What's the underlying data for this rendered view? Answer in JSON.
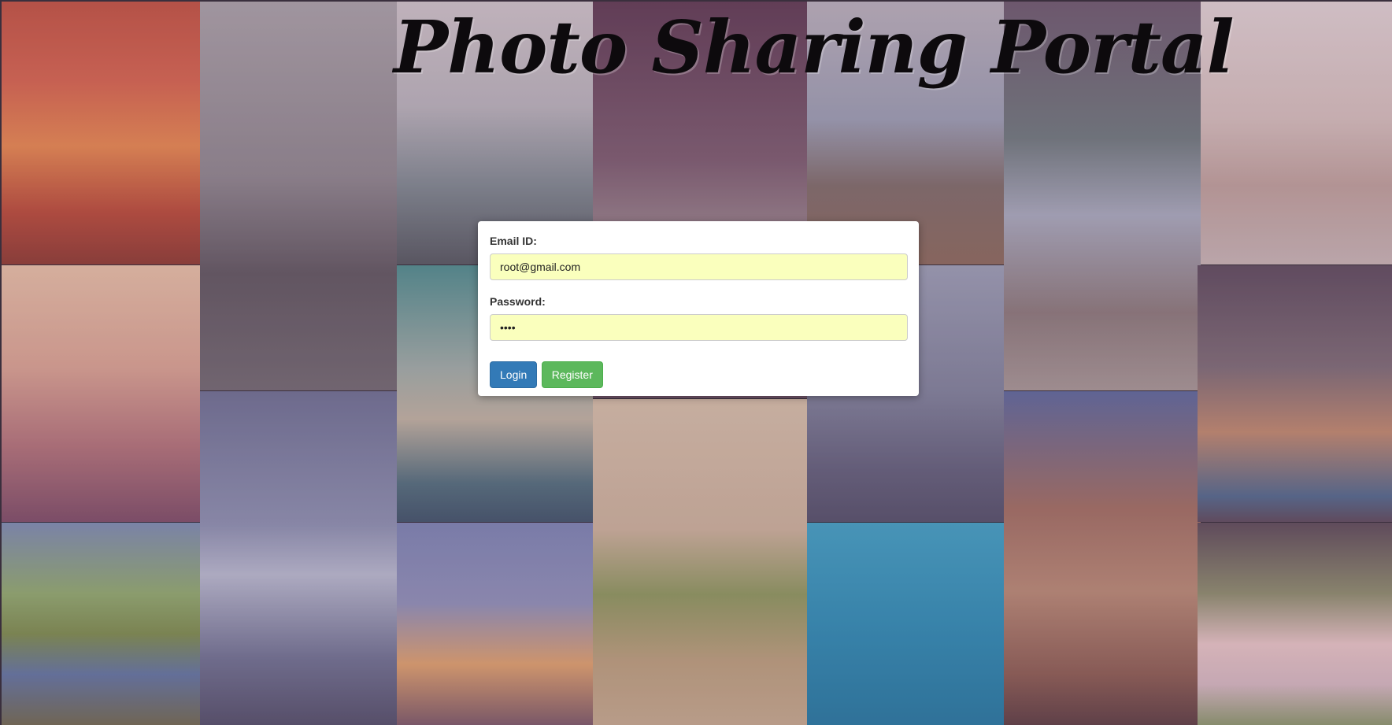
{
  "header": {
    "title": "Photo Sharing Portal"
  },
  "login_form": {
    "email_label": "Email ID:",
    "email_value": "root@gmail.com",
    "password_label": "Password:",
    "password_value": "••••",
    "login_label": "Login",
    "register_label": "Register"
  },
  "colors": {
    "login_button": "#337ab7",
    "register_button": "#5cb85c",
    "autofill_field": "#faffbd"
  },
  "background_photos": [
    "sunset-pier-photo",
    "woman-sweeping-photo",
    "city-skyline-photo",
    "child-window-photo",
    "coastal-cliff-photo",
    "waterfall-photo",
    "girl-on-beach-photo",
    "hot-air-balloons-photo",
    "tv-tower-skyline-photo",
    "fisherman-lake-photo",
    "street-musician-photo",
    "statue-of-liberty-photo",
    "child-on-path-photo",
    "cliff-waterfall-photo",
    "mountain-lake-flowers-photo",
    "golden-gate-sunset-photo",
    "boat-on-water-photo",
    "children-in-garden-photo"
  ]
}
